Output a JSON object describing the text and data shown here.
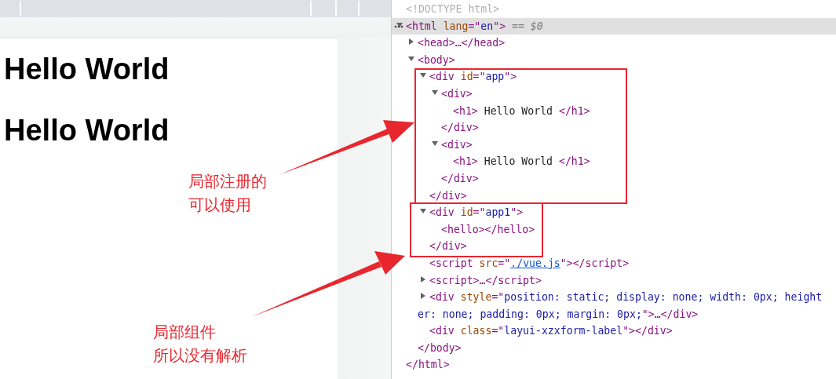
{
  "page": {
    "headings": [
      "Hello World",
      "Hello World"
    ]
  },
  "elements_tree": [
    {
      "parts": [
        {
          "kind": "doctype",
          "text": "<!DOCTYPE html>"
        }
      ],
      "selected": false
    },
    {
      "parts": [
        {
          "kind": "tag",
          "text": "<html "
        },
        {
          "kind": "attr",
          "text": "lang"
        },
        {
          "kind": "tag",
          "text": "=\""
        },
        {
          "kind": "value",
          "text": "en"
        },
        {
          "kind": "tag",
          "text": "\">"
        },
        {
          "kind": "ref",
          "text": " == $0"
        }
      ],
      "selected": true,
      "expanded": true,
      "children": [
        {
          "parts": [
            {
              "kind": "tag",
              "text": "<head>…</head>"
            }
          ],
          "selected": false,
          "expanded": false
        },
        {
          "parts": [
            {
              "kind": "tag",
              "text": "<body>"
            }
          ],
          "selected": false,
          "expanded": true,
          "children": [
            {
              "parts": [
                {
                  "kind": "tag",
                  "text": "<div "
                },
                {
                  "kind": "attr",
                  "text": "id"
                },
                {
                  "kind": "tag",
                  "text": "=\""
                },
                {
                  "kind": "value",
                  "text": "app"
                },
                {
                  "kind": "tag",
                  "text": "\">"
                }
              ],
              "selected": false,
              "expanded": true,
              "children": [
                {
                  "parts": [
                    {
                      "kind": "tag",
                      "text": "<div>"
                    }
                  ],
                  "selected": false,
                  "expanded": true,
                  "children": [
                    {
                      "parts": [
                        {
                          "kind": "tag",
                          "text": "<h1>"
                        },
                        {
                          "kind": "text",
                          "text": " Hello World "
                        },
                        {
                          "kind": "tag",
                          "text": "</h1>"
                        }
                      ],
                      "selected": false
                    }
                  ],
                  "close": [
                    {
                      "kind": "tag",
                      "text": "</div>"
                    }
                  ]
                },
                {
                  "parts": [
                    {
                      "kind": "tag",
                      "text": "<div>"
                    }
                  ],
                  "selected": false,
                  "expanded": true,
                  "children": [
                    {
                      "parts": [
                        {
                          "kind": "tag",
                          "text": "<h1>"
                        },
                        {
                          "kind": "text",
                          "text": " Hello World "
                        },
                        {
                          "kind": "tag",
                          "text": "</h1>"
                        }
                      ],
                      "selected": false
                    }
                  ],
                  "close": [
                    {
                      "kind": "tag",
                      "text": "</div>"
                    }
                  ]
                }
              ],
              "close": [
                {
                  "kind": "tag",
                  "text": "</div>"
                }
              ]
            },
            {
              "parts": [
                {
                  "kind": "tag",
                  "text": "<div "
                },
                {
                  "kind": "attr",
                  "text": "id"
                },
                {
                  "kind": "tag",
                  "text": "=\""
                },
                {
                  "kind": "value",
                  "text": "app1"
                },
                {
                  "kind": "tag",
                  "text": "\">"
                }
              ],
              "selected": false,
              "expanded": true,
              "children": [
                {
                  "parts": [
                    {
                      "kind": "tag",
                      "text": "<hello></hello>"
                    }
                  ],
                  "selected": false
                }
              ],
              "close": [
                {
                  "kind": "tag",
                  "text": "</div>"
                }
              ]
            },
            {
              "parts": [
                {
                  "kind": "tag",
                  "text": "<script "
                },
                {
                  "kind": "attr",
                  "text": "src"
                },
                {
                  "kind": "tag",
                  "text": "=\""
                },
                {
                  "kind": "link",
                  "text": "./vue.js"
                },
                {
                  "kind": "tag",
                  "text": "\"></script>"
                }
              ],
              "selected": false
            },
            {
              "parts": [
                {
                  "kind": "tag",
                  "text": "<script>…</script>"
                }
              ],
              "selected": false,
              "expanded": false
            },
            {
              "parts": [
                {
                  "kind": "tag",
                  "text": "<div "
                },
                {
                  "kind": "attr",
                  "text": "style"
                },
                {
                  "kind": "tag",
                  "text": "=\""
                },
                {
                  "kind": "value",
                  "text": "position: static; display: none; width: 0px; height"
                }
              ],
              "wrap_parts": [
                {
                  "kind": "value",
                  "text": "er: none; padding: 0px; margin: 0px;"
                },
                {
                  "kind": "tag",
                  "text": "\">…</div>"
                }
              ],
              "selected": false,
              "expanded": false
            },
            {
              "parts": [
                {
                  "kind": "tag",
                  "text": "<div "
                },
                {
                  "kind": "attr",
                  "text": "class"
                },
                {
                  "kind": "tag",
                  "text": "=\""
                },
                {
                  "kind": "value",
                  "text": "layui-xzxform-label"
                },
                {
                  "kind": "tag",
                  "text": "\"></div>"
                }
              ],
              "selected": false
            }
          ],
          "close": [
            {
              "kind": "tag",
              "text": "</body>"
            }
          ]
        }
      ],
      "close": [
        {
          "kind": "tag",
          "text": "</html>"
        }
      ]
    }
  ],
  "annotations": [
    {
      "lines": [
        "局部注册的",
        "可以使用"
      ]
    },
    {
      "lines": [
        "局部组件",
        "所以没有解析"
      ]
    }
  ]
}
